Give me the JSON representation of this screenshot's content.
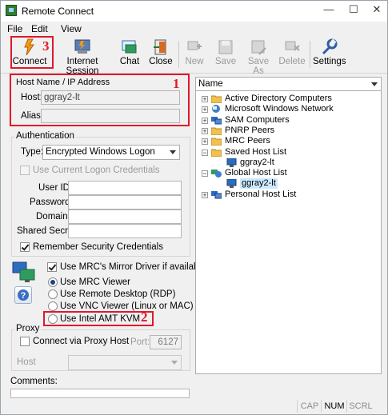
{
  "window": {
    "title": "Remote Connect"
  },
  "menu": [
    "File",
    "Edit",
    "View"
  ],
  "toolbar": [
    {
      "label": "Connect",
      "icon": "connect-icon",
      "enabled": true
    },
    {
      "label": "Internet Session",
      "icon": "internet-session-icon",
      "enabled": true
    },
    {
      "label": "Chat",
      "icon": "chat-icon",
      "enabled": true
    },
    {
      "label": "Close",
      "icon": "close-session-icon",
      "enabled": true
    },
    {
      "label": "New",
      "icon": "new-icon",
      "enabled": false
    },
    {
      "label": "Save",
      "icon": "save-icon",
      "enabled": false
    },
    {
      "label": "Save As",
      "icon": "save-as-icon",
      "enabled": false
    },
    {
      "label": "Delete",
      "icon": "delete-icon",
      "enabled": false
    },
    {
      "label": "Settings",
      "icon": "settings-icon",
      "enabled": true
    }
  ],
  "host_group": {
    "title": "Host Name / IP Address",
    "host_label": "Host:",
    "host_value": "ggray2-lt",
    "alias_label": "Alias:",
    "alias_value": ""
  },
  "auth": {
    "title": "Authentication",
    "type_label": "Type:",
    "type_value": "Encrypted Windows Logon",
    "use_current_label": "Use Current Logon Credentials",
    "use_current_checked": false,
    "userid_label": "User ID:",
    "password_label": "Password:",
    "domain_label": "Domain:",
    "shared_secret_label": "Shared Secret:",
    "remember_label": "Remember Security Credentials",
    "remember_checked": true
  },
  "viewer": {
    "mirror_label": "Use MRC's Mirror Driver if available",
    "mirror_checked": true,
    "options": [
      {
        "label": "Use MRC Viewer",
        "checked": true
      },
      {
        "label": "Use Remote Desktop (RDP)",
        "checked": false
      },
      {
        "label": "Use VNC Viewer (Linux or MAC)",
        "checked": false
      },
      {
        "label": "Use Intel AMT KVM",
        "checked": false
      }
    ]
  },
  "proxy": {
    "title": "Proxy",
    "connect_label": "Connect via Proxy Host",
    "connect_checked": false,
    "port_label": "Port:",
    "port_value": "6127",
    "host_label": "Host"
  },
  "comments_label": "Comments:",
  "tree": {
    "header": "Name",
    "items": [
      {
        "label": "Active Directory Computers",
        "icon": "folder-icon",
        "level": 0,
        "expander": "+"
      },
      {
        "label": "Microsoft Windows Network",
        "icon": "network-icon",
        "level": 0,
        "expander": "+"
      },
      {
        "label": "SAM Computers",
        "icon": "computers-icon",
        "level": 0,
        "expander": "+"
      },
      {
        "label": "PNRP Peers",
        "icon": "folder-icon",
        "level": 0,
        "expander": "+"
      },
      {
        "label": "MRC Peers",
        "icon": "folder-icon",
        "level": 0,
        "expander": "+"
      },
      {
        "label": "Saved Host List",
        "icon": "folder-icon",
        "level": 0,
        "expander": "-"
      },
      {
        "label": "ggray2-lt",
        "icon": "computer-icon",
        "level": 1,
        "expander": ""
      },
      {
        "label": "Global Host List",
        "icon": "globe-icon",
        "level": 0,
        "expander": "-"
      },
      {
        "label": "ggray2-lt",
        "icon": "computer-icon",
        "level": 1,
        "expander": "",
        "selected": true
      },
      {
        "label": "Personal Host List",
        "icon": "computers-icon",
        "level": 0,
        "expander": "+"
      }
    ]
  },
  "annotations": [
    "1",
    "2",
    "3"
  ],
  "status": [
    {
      "label": "CAP",
      "active": false
    },
    {
      "label": "NUM",
      "active": true
    },
    {
      "label": "SCRL",
      "active": false
    }
  ],
  "colors": {
    "annotation": "#e0182b",
    "selection": "#cce8ff"
  }
}
